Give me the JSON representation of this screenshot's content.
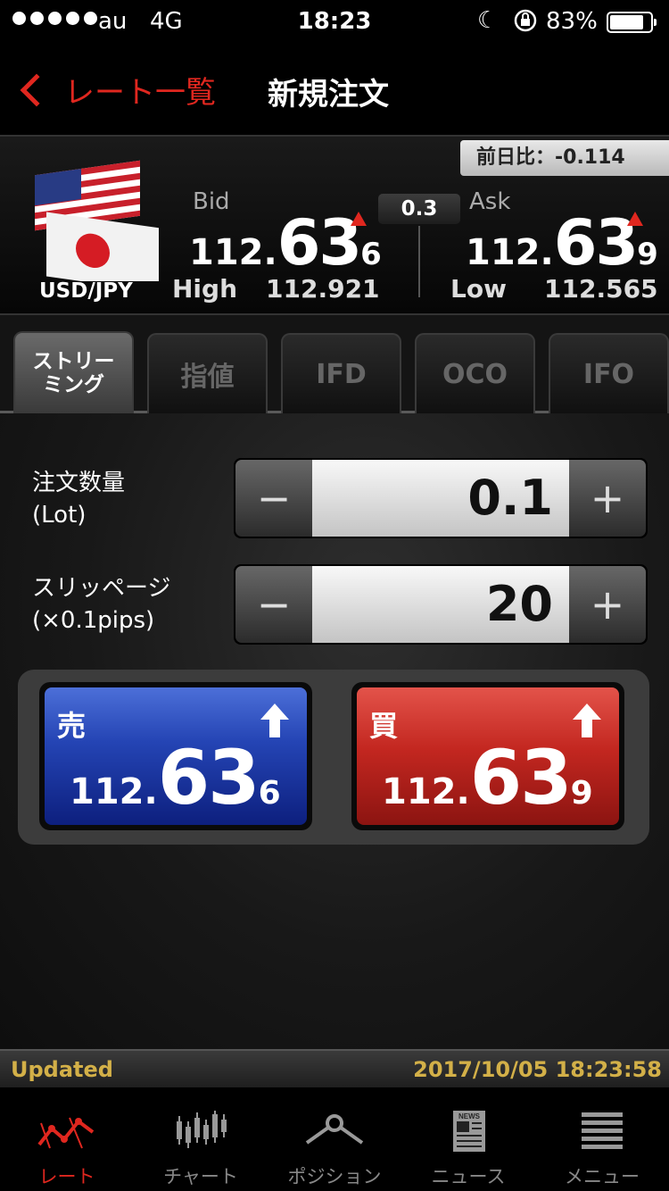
{
  "status_bar": {
    "carrier": "au",
    "network": "4G",
    "time": "18:23",
    "battery_percent": "83%",
    "battery_level": 0.83
  },
  "nav": {
    "back_label": "レート一覧",
    "title": "新規注文"
  },
  "rate": {
    "day_change": "前日比：-0.114",
    "pair": "USD/JPY",
    "bid_label": "Bid",
    "bid_prefix": "112.",
    "bid_main": "63",
    "bid_suffix": "6",
    "ask_label": "Ask",
    "ask_prefix": "112.",
    "ask_main": "63",
    "ask_suffix": "9",
    "spread": "0.3",
    "high_label": "High",
    "high_value": "112.921",
    "low_label": "Low",
    "low_value": "112.565"
  },
  "tabs": [
    {
      "label": "ストリーミング",
      "line1": "ストリー",
      "line2": "ミング",
      "active": true
    },
    {
      "label": "指値",
      "active": false
    },
    {
      "label": "IFD",
      "active": false
    },
    {
      "label": "OCO",
      "active": false
    },
    {
      "label": "IFO",
      "active": false
    }
  ],
  "order": {
    "quantity_label_line1": "注文数量",
    "quantity_label_line2": "(Lot)",
    "quantity_value": "0.1",
    "slippage_label_line1": "スリッページ",
    "slippage_label_line2": "(×0.1pips)",
    "slippage_value": "20",
    "minus": "−",
    "plus": "+"
  },
  "sell": {
    "label": "売",
    "prefix": "112.",
    "main": "63",
    "suffix": "6"
  },
  "buy": {
    "label": "買",
    "prefix": "112.",
    "main": "63",
    "suffix": "9"
  },
  "updated": {
    "label": "Updated",
    "timestamp": "2017/10/05 18:23:58"
  },
  "tabbar": [
    {
      "label": "レート",
      "icon": "rate-icon",
      "active": true
    },
    {
      "label": "チャート",
      "icon": "chart-icon",
      "active": false
    },
    {
      "label": "ポジション",
      "icon": "position-icon",
      "active": false
    },
    {
      "label": "ニュース",
      "icon": "news-icon",
      "active": false
    },
    {
      "label": "メニュー",
      "icon": "menu-icon",
      "active": false
    }
  ],
  "colors": {
    "accent": "#e0271f",
    "sell": "#2444b4",
    "buy": "#c32720",
    "updated_text": "#d3b048"
  }
}
